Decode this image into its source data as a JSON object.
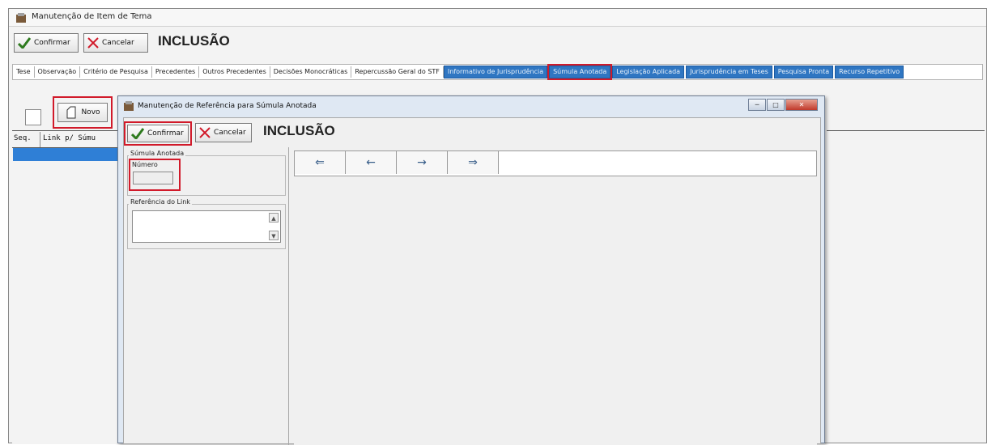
{
  "main_window": {
    "title": "Manutenção de Item de Tema",
    "toolbar": {
      "confirm_label": "Confirmar",
      "cancel_label": "Cancelar",
      "mode_label": "INCLUSÃO"
    },
    "tabs": [
      {
        "label": "Tese",
        "style": "plain"
      },
      {
        "label": "Observação",
        "style": "plain"
      },
      {
        "label": "Critério de Pesquisa",
        "style": "plain"
      },
      {
        "label": "Precedentes",
        "style": "plain"
      },
      {
        "label": "Outros Precedentes",
        "style": "plain"
      },
      {
        "label": "Decisões Monocráticas",
        "style": "plain"
      },
      {
        "label": "Repercussão Geral do STF",
        "style": "plain"
      },
      {
        "label": "Informativo de Jurisprudência",
        "style": "highlight"
      },
      {
        "label": "Súmula Anotada",
        "style": "selected"
      },
      {
        "label": "Legislação Aplicada",
        "style": "highlight"
      },
      {
        "label": "Jurisprudência em Teses",
        "style": "highlight"
      },
      {
        "label": "Pesquisa Pronta",
        "style": "highlight"
      },
      {
        "label": "Recurso Repetitivo",
        "style": "highlight"
      }
    ],
    "new_button_label": "Novo",
    "grid_headers": {
      "seq": "Seq.",
      "link": "Link p/ Súmu"
    }
  },
  "dialog": {
    "title": "Manutenção de Referência para Súmula Anotada",
    "toolbar": {
      "confirm_label": "Confirmar",
      "cancel_label": "Cancelar",
      "mode_label": "INCLUSÃO"
    },
    "group_sumula_label": "Súmula Anotada",
    "numero_label": "Número",
    "numero_value": "",
    "group_referencia_label": "Referência do Link",
    "referencia_value": "",
    "nav_icons": [
      "first-record-icon",
      "previous-record-icon",
      "next-record-icon",
      "last-record-icon"
    ]
  },
  "colors": {
    "highlight_red": "#d11a2a",
    "tab_blue": "#2f76c2",
    "selection_blue": "#2f7fd6"
  }
}
